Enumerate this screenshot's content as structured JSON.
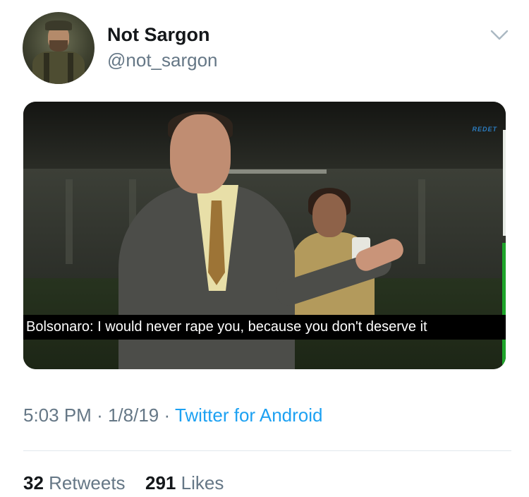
{
  "tweet": {
    "author": {
      "display_name": "Not Sargon",
      "handle": "@not_sargon",
      "avatar_icon": "user-avatar"
    },
    "media": {
      "watermark": "REDET",
      "subtitle": "Bolsonaro: I would never rape you, because you don't deserve it"
    },
    "meta": {
      "time": "5:03 PM",
      "separator": "·",
      "date": "1/8/19",
      "source": "Twitter for Android"
    },
    "stats": {
      "retweets_count": "32",
      "retweets_label": "Retweets",
      "likes_count": "291",
      "likes_label": "Likes"
    },
    "menu_icon": "chevron-down-icon",
    "colors": {
      "link": "#1da1f2",
      "secondary_text": "#657786",
      "primary_text": "#14171a",
      "divider": "#e1e8ed"
    }
  }
}
